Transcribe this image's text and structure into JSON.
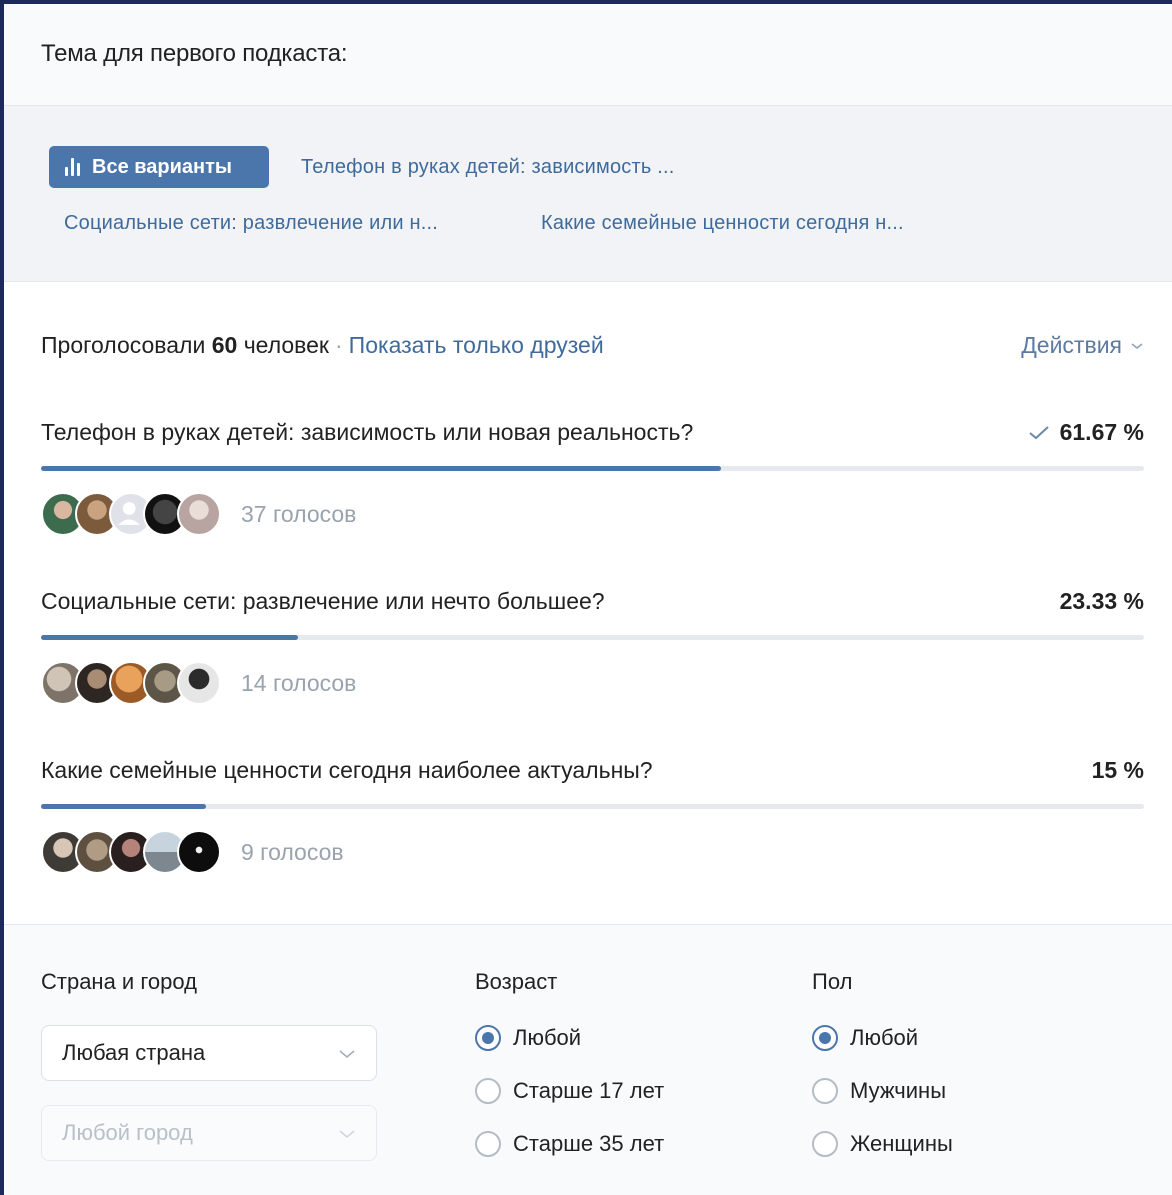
{
  "poll": {
    "title": "Тема для первого подкаста:",
    "tabs": {
      "all": "Все варианты",
      "t1": "Телефон в руках детей: зависимость ...",
      "t2": "Социальные сети: развлечение или н...",
      "t3": "Какие семейные ценности сегодня н..."
    },
    "summary": {
      "prefix": "Проголосовали",
      "count": "60",
      "suffix": "человек",
      "friends": "Показать только друзей",
      "actions": "Действия"
    },
    "options": [
      {
        "label": "Телефон в руках детей: зависимость или новая реальность?",
        "percent": "61.67 %",
        "fraction": 0.6167,
        "votes": "37 голосов",
        "checked": true
      },
      {
        "label": "Социальные сети: развлечение или нечто большее?",
        "percent": "23.33 %",
        "fraction": 0.2333,
        "votes": "14 голосов",
        "checked": false
      },
      {
        "label": "Какие семейные ценности сегодня наиболее актуальны?",
        "percent": "15 %",
        "fraction": 0.15,
        "votes": "9 голосов",
        "checked": false
      }
    ]
  },
  "filters": {
    "location": {
      "heading": "Страна и город",
      "country": "Любая страна",
      "city": "Любой город"
    },
    "age": {
      "heading": "Возраст",
      "options": [
        "Любой",
        "Старше 17 лет",
        "Старше 35 лет"
      ],
      "selected": 0
    },
    "gender": {
      "heading": "Пол",
      "options": [
        "Любой",
        "Мужчины",
        "Женщины"
      ],
      "selected": 0
    }
  },
  "colors": {
    "accent": "#4b76ab",
    "link": "#3f6b9c",
    "muted": "#9aa3ad"
  }
}
